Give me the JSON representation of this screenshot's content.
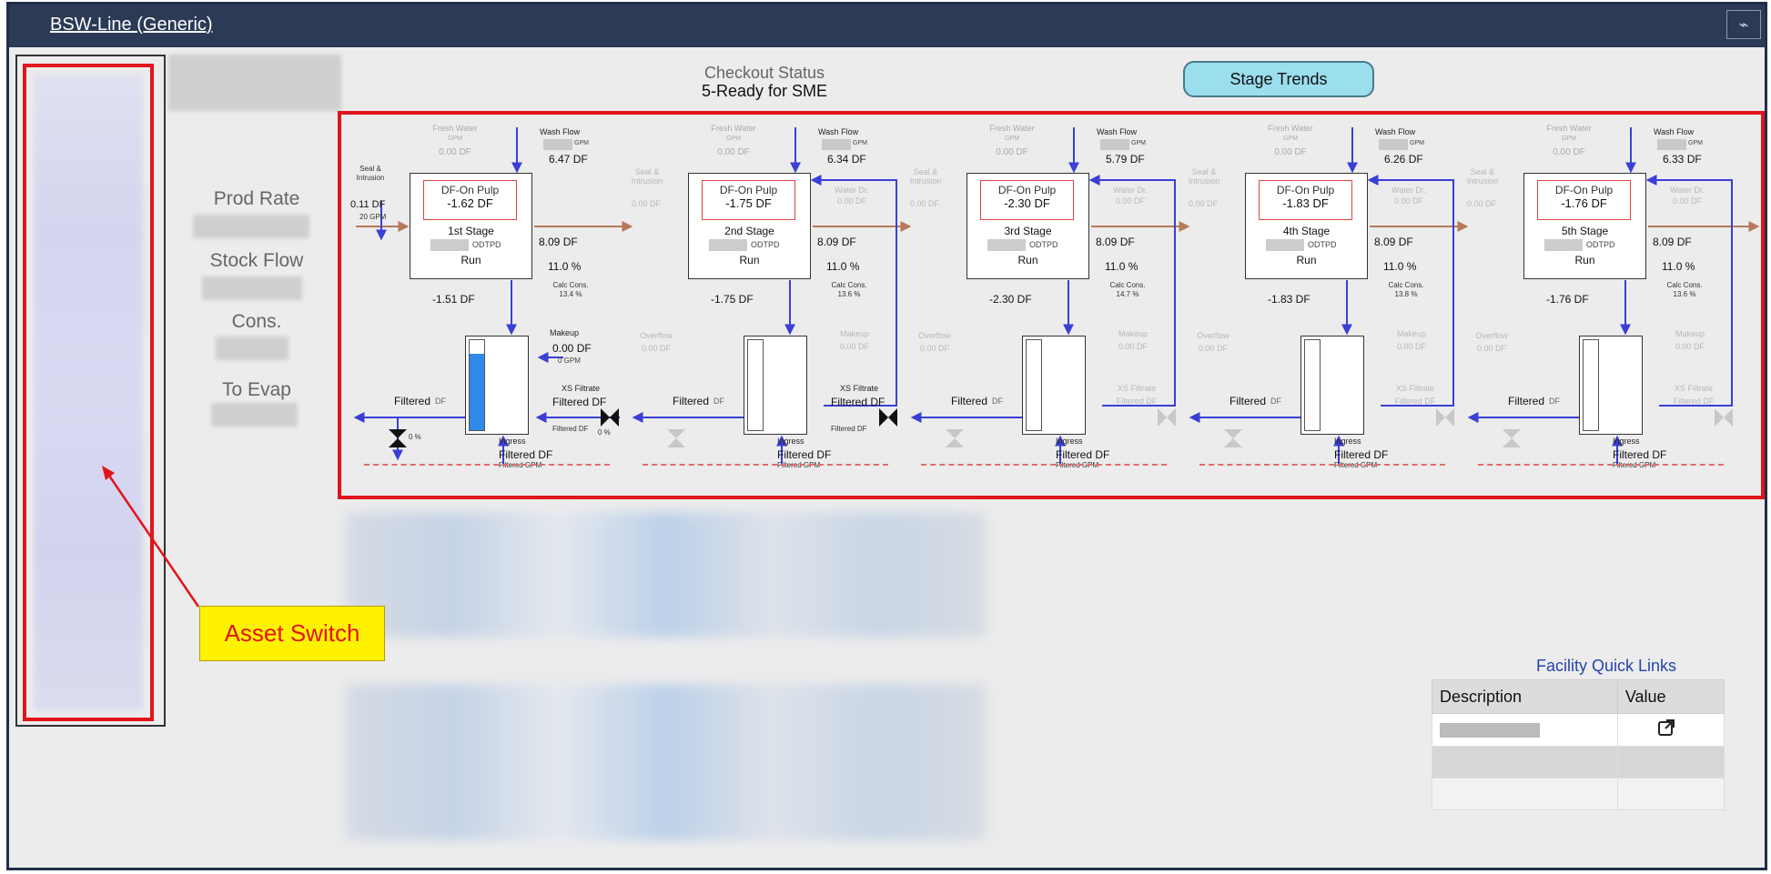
{
  "header": {
    "title": "BSW-Line (Generic)",
    "trend_icon": "chart-icon"
  },
  "status": {
    "label": "Checkout Status",
    "value": "5-Ready for SME"
  },
  "stage_trends_button": "Stage Trends",
  "callout": "Asset Switch",
  "left_labels": {
    "prod_rate": "Prod Rate",
    "stock_flow": "Stock Flow",
    "cons": "Cons.",
    "to_evap": "To Evap"
  },
  "diagram": {
    "common": {
      "fresh_water": "Fresh Water",
      "gpm": "GPM",
      "df": "DF",
      "wash_flow": "Wash Flow",
      "df_on_pulp": "DF-On Pulp",
      "odtpd": "ODTPD",
      "run": "Run",
      "pct": "%",
      "calc_cons": "Calc Cons.",
      "filtered": "Filtered",
      "filtered_gpm": "Filtered GPM",
      "filtered_df_small": "Filtered DF",
      "ingress": "Ingress",
      "xs_filtrate": "XS Filtrate",
      "overflow": "Overflow",
      "makeup": "Makeup",
      "water_dr": "Water Dr.",
      "seal_intrusion": "Seal & Intrusion",
      "zero_df": "0.00 DF",
      "zero_gpm": "0 GPM",
      "zero_pct": "0 %"
    },
    "first_stage_extras": {
      "seal_df": "0.11 DF",
      "seal_gpm": "20 GPM",
      "makeup_value": "0.00 DF",
      "makeup_unit": "0 GPM"
    },
    "stages": [
      {
        "name": "1st Stage",
        "df_on_pulp": "-1.62 DF",
        "wash_flow_df": "6.47 DF",
        "out_df": "8.09 DF",
        "out_pct": "11.0 %",
        "calc_value": "13.4 %",
        "below_df": "-1.51 DF",
        "tank_level": 0.85
      },
      {
        "name": "2nd Stage",
        "df_on_pulp": "-1.75 DF",
        "wash_flow_df": "6.34 DF",
        "out_df": "8.09 DF",
        "out_pct": "11.0 %",
        "calc_value": "13.6 %",
        "below_df": "-1.75 DF",
        "tank_level": 0.0
      },
      {
        "name": "3rd Stage",
        "df_on_pulp": "-2.30 DF",
        "wash_flow_df": "5.79 DF",
        "out_df": "8.09 DF",
        "out_pct": "11.0 %",
        "calc_value": "14.7 %",
        "below_df": "-2.30 DF",
        "tank_level": 0.0
      },
      {
        "name": "4th Stage",
        "df_on_pulp": "-1.83 DF",
        "wash_flow_df": "6.26 DF",
        "out_df": "8.09 DF",
        "out_pct": "11.0 %",
        "calc_value": "13.8 %",
        "below_df": "-1.83 DF",
        "tank_level": 0.0
      },
      {
        "name": "5th Stage",
        "df_on_pulp": "-1.76 DF",
        "wash_flow_df": "6.33 DF",
        "out_df": "8.09 DF",
        "out_pct": "11.0 %",
        "calc_value": "13.6 %",
        "below_df": "-1.76 DF",
        "tank_level": 0.0
      }
    ]
  },
  "quick_links": {
    "title": "Facility Quick Links",
    "headers": [
      "Description",
      "Value"
    ],
    "open_icon": "external-link-icon"
  },
  "colors": {
    "accent_red": "#e2141b",
    "flow_blue": "#3b3fd6",
    "stock_brown": "#b8785a",
    "tank_blue": "#2e8ae6",
    "button_cyan": "#9bdfef"
  }
}
